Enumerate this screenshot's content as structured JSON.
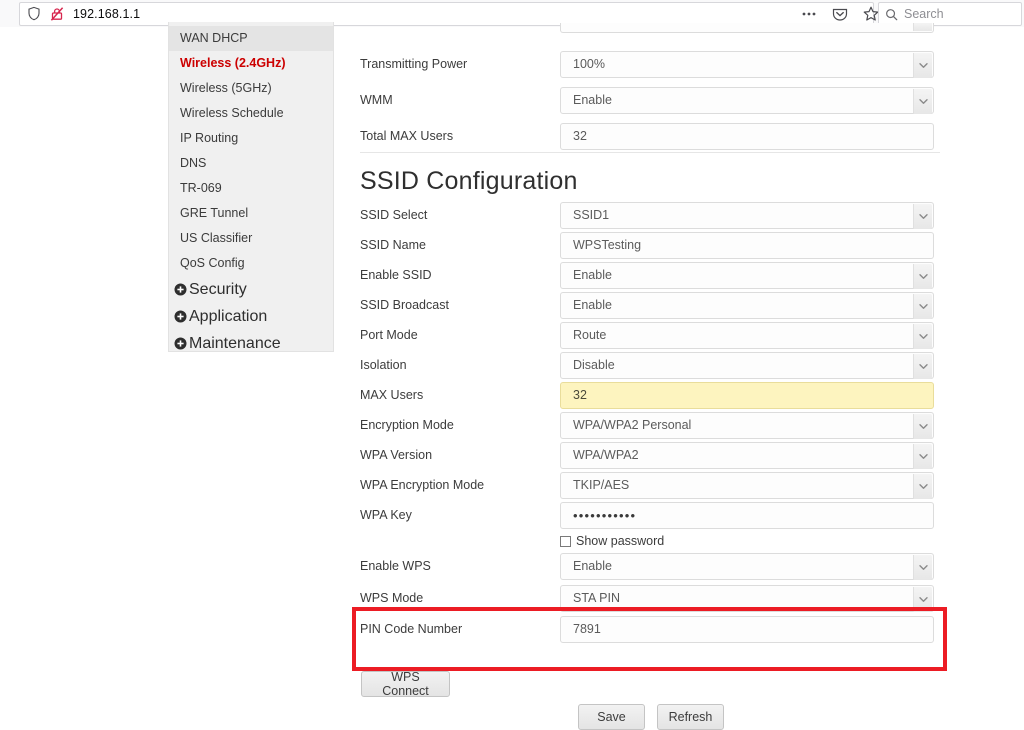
{
  "browser": {
    "url": "192.168.1.1",
    "shield_icon": "shield-icon",
    "insecure_login_icon": "crossed-out-lock-icon",
    "menu_icon": "more-options-icon",
    "pocket_icon": "pocket-icon",
    "bookmark_icon": "star-icon",
    "search_placeholder": "Search",
    "search_icon": "search-icon"
  },
  "sidebar": {
    "items": [
      {
        "label": "WAN DHCP",
        "state": "shaded"
      },
      {
        "label": "Wireless (2.4GHz)",
        "state": "active"
      },
      {
        "label": "Wireless (5GHz)",
        "state": "normal"
      },
      {
        "label": "Wireless Schedule",
        "state": "normal"
      },
      {
        "label": "IP Routing",
        "state": "normal"
      },
      {
        "label": "DNS",
        "state": "normal"
      },
      {
        "label": "TR-069",
        "state": "normal"
      },
      {
        "label": "GRE Tunnel",
        "state": "normal"
      },
      {
        "label": "US Classifier",
        "state": "normal"
      },
      {
        "label": "QoS Config",
        "state": "normal"
      }
    ],
    "groups": [
      {
        "label": "Security",
        "icon": "plus-expand-icon"
      },
      {
        "label": "Application",
        "icon": "plus-expand-icon"
      },
      {
        "label": "Maintenance",
        "icon": "plus-expand-icon"
      }
    ]
  },
  "form": {
    "top_rows": [
      {
        "label": "Transmitting Power",
        "value": "100%",
        "type": "select"
      },
      {
        "label": "WMM",
        "value": "Enable",
        "type": "select"
      },
      {
        "label": "Total MAX Users",
        "value": "32",
        "type": "text"
      }
    ],
    "section_title": "SSID Configuration",
    "ssid_rows": [
      {
        "label": "SSID Select",
        "value": "SSID1",
        "type": "select"
      },
      {
        "label": "SSID Name",
        "value": "WPSTesting",
        "type": "text"
      },
      {
        "label": "Enable SSID",
        "value": "Enable",
        "type": "select"
      },
      {
        "label": "SSID Broadcast",
        "value": "Enable",
        "type": "select"
      },
      {
        "label": "Port Mode",
        "value": "Route",
        "type": "select"
      },
      {
        "label": "Isolation",
        "value": "Disable",
        "type": "select"
      },
      {
        "label": "MAX Users",
        "value": "32",
        "type": "text-autofill"
      },
      {
        "label": "Encryption Mode",
        "value": "WPA/WPA2 Personal",
        "type": "select"
      },
      {
        "label": "WPA Version",
        "value": "WPA/WPA2",
        "type": "select"
      },
      {
        "label": "WPA Encryption Mode",
        "value": "TKIP/AES",
        "type": "select"
      },
      {
        "label": "WPA Key",
        "value": "•••••••••••",
        "type": "password"
      }
    ],
    "show_password_label": "Show password",
    "wps_rows": [
      {
        "label": "Enable WPS",
        "value": "Enable",
        "type": "select"
      },
      {
        "label": "WPS Mode",
        "value": "STA PIN",
        "type": "select"
      },
      {
        "label": "PIN Code Number",
        "value": "7891",
        "type": "text"
      }
    ],
    "wps_connect_label": "WPS Connect",
    "save_label": "Save",
    "refresh_label": "Refresh",
    "highlight_color": "#ec1c24",
    "active_nav_color": "#cc0000",
    "autofill_color": "#fdf4bf"
  }
}
